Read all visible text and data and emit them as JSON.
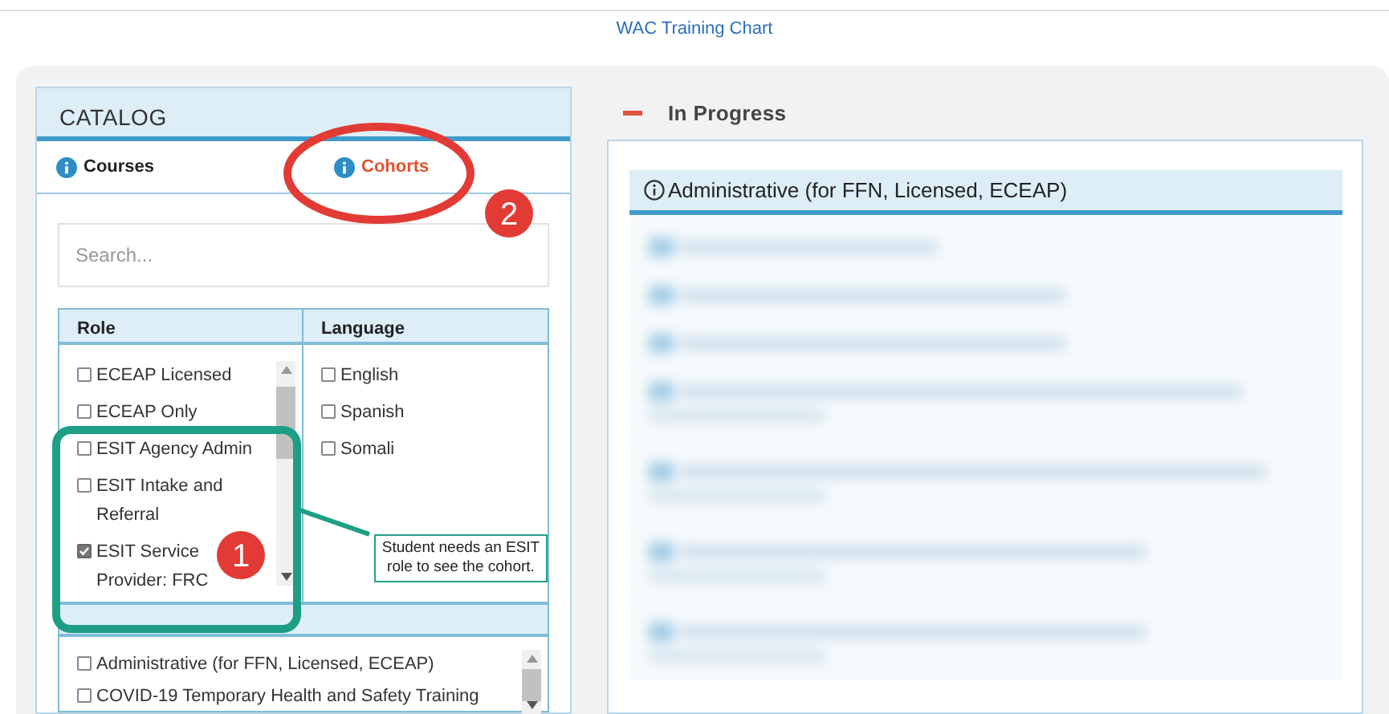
{
  "title": "WAC Training Chart",
  "catalog": {
    "heading": "CATALOG",
    "tabs": [
      {
        "label": "Courses",
        "selected": false
      },
      {
        "label": "Cohorts",
        "selected": true
      }
    ],
    "search": {
      "placeholder": "Search..."
    },
    "columns": [
      "Role",
      "Language"
    ],
    "role_options": [
      {
        "label": "ECEAP Licensed",
        "checked": false
      },
      {
        "label": "ECEAP Only",
        "checked": false
      },
      {
        "label": "ESIT Agency Admin",
        "checked": false
      },
      {
        "label": "ESIT Intake and Referral",
        "checked": false
      },
      {
        "label": "ESIT Service Provider: FRC",
        "checked": true
      }
    ],
    "language_options": [
      {
        "label": "English",
        "checked": false
      },
      {
        "label": "Spanish",
        "checked": false
      },
      {
        "label": "Somali",
        "checked": false
      }
    ],
    "topic_options": [
      {
        "label": "Administrative (for FFN, Licensed, ECEAP)",
        "checked": false
      },
      {
        "label": "COVID-19 Temporary Health and Safety Training",
        "checked": false
      }
    ]
  },
  "in_progress": {
    "heading": "In Progress",
    "expanded": true,
    "group_title": "Administrative (for FFN, Licensed, ECEAP)"
  },
  "annotations": [
    {
      "kind": "ellipse"
    },
    {
      "kind": "badge",
      "label": "2"
    },
    {
      "kind": "frame"
    },
    {
      "kind": "badge",
      "label": "1"
    },
    {
      "kind": "callout",
      "text": "Student needs an ESIT role to see the cohort."
    }
  ]
}
